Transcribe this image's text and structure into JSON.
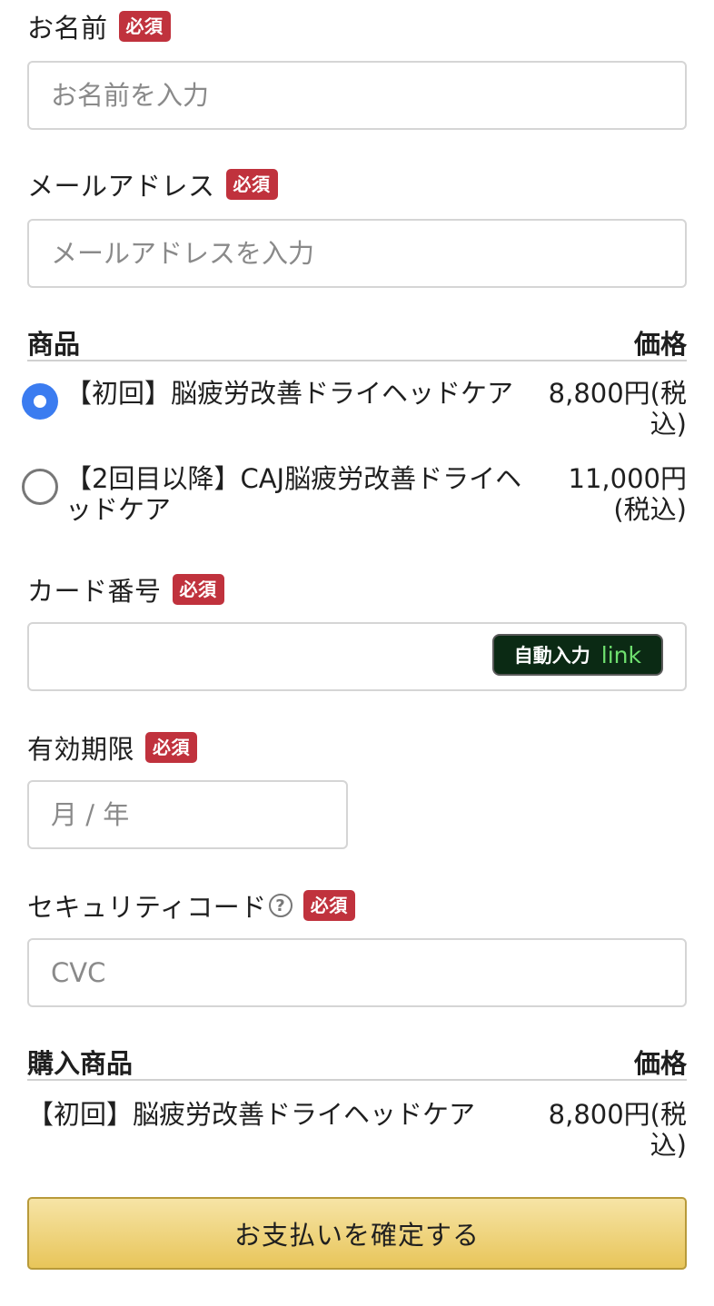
{
  "required_badge": "必須",
  "name": {
    "label": "お名前",
    "placeholder": "お名前を入力"
  },
  "email": {
    "label": "メールアドレス",
    "placeholder": "メールアドレスを入力"
  },
  "products": {
    "header_product": "商品",
    "header_price": "価格",
    "options": [
      {
        "name": "【初回】脳疲労改善ドライヘッドケア",
        "price": "8,800円(税込)",
        "selected": true
      },
      {
        "name": "【2回目以降】CAJ脳疲労改善ドライヘッドケア",
        "price": "11,000円(税込)",
        "selected": false
      }
    ]
  },
  "card_number": {
    "label": "カード番号",
    "autofill_label": "自動入力",
    "autofill_brand": "link"
  },
  "expiry": {
    "label": "有効期限",
    "placeholder": "月 / 年"
  },
  "security_code": {
    "label": "セキュリティコード",
    "help_icon": "?",
    "placeholder": "CVC"
  },
  "summary": {
    "header_product": "購入商品",
    "header_price": "価格",
    "item_name": "【初回】脳疲労改善ドライヘッドケア",
    "item_price": "8,800円(税込)"
  },
  "submit_label": "お支払いを確定する",
  "colors": {
    "required": "#c0323d",
    "radio_selected": "#3b7cf0",
    "submit_top": "#f6e4a6",
    "submit_bottom": "#e8c55a",
    "link_bg": "#0b2a14",
    "link_green": "#6fe06f"
  }
}
